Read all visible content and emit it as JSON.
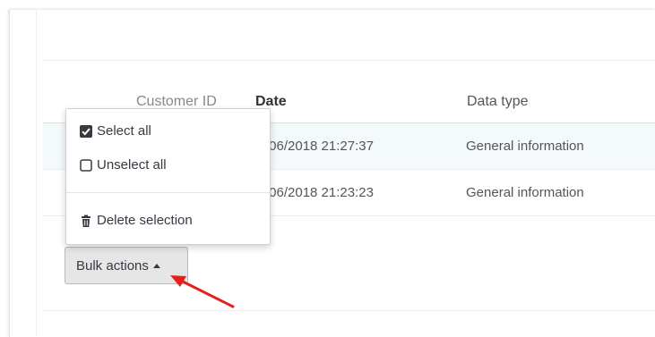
{
  "table": {
    "headers": {
      "customer_id": "Customer ID",
      "date": "Date",
      "data_type": "Data type"
    },
    "rows": [
      {
        "date": "/06/2018 21:27:37",
        "data_type": "General information"
      },
      {
        "date": "/06/2018 21:23:23",
        "data_type": "General information"
      }
    ]
  },
  "dropdown": {
    "select_all": "Select all",
    "unselect_all": "Unselect all",
    "delete_selection": "Delete selection"
  },
  "bulk_actions": {
    "label": "Bulk actions"
  },
  "icons": {
    "select_all": "checked-checkbox-icon",
    "unselect_all": "empty-checkbox-icon",
    "delete": "trash-icon",
    "caret": "caret-up-icon"
  },
  "colors": {
    "annotation_arrow": "#e3211c",
    "row_highlight": "#f4f9fb"
  }
}
